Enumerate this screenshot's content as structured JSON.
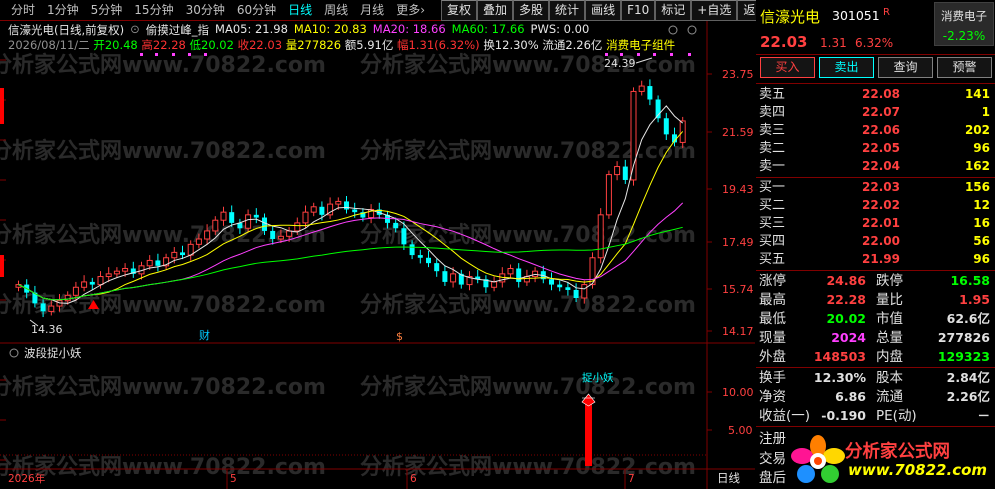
{
  "toolbar": {
    "tabs": [
      "分时",
      "1分钟",
      "5分钟",
      "15分钟",
      "30分钟",
      "60分钟",
      "日线",
      "周线",
      "月线",
      "更多›"
    ],
    "active_tab": "日线",
    "buttons": [
      "复权",
      "叠加",
      "多股",
      "统计",
      "画线",
      "F10",
      "标记",
      "+自选",
      "返回"
    ]
  },
  "info_line1": {
    "title": "信濠光电(日线,前复权)",
    "indicator": "偷摸过峰_指",
    "ma05": "MA05: 21.98",
    "ma10": "MA10: 20.83",
    "ma20": "MA20: 18.66",
    "ma60": "MA60: 17.66",
    "pws": "PWS: 0.00"
  },
  "info_line2": {
    "date": "2026/08/11/二",
    "open": "开20.48",
    "high": "高22.28",
    "low": "低20.02",
    "close": "收22.03",
    "volume": "量277826",
    "amount": "额5.91亿",
    "range": "幅1.31(6.32%)",
    "turnover": "换12.30%",
    "float": "流通2.26亿",
    "sector": "消费电子组件"
  },
  "price_axis": [
    "23.75",
    "21.59",
    "19.43",
    "17.49",
    "15.74",
    "14.17"
  ],
  "price_marks": {
    "max_label": "24.39",
    "min_label": "14.36"
  },
  "event_marks": {
    "fin": "财",
    "dollar": "$"
  },
  "sub_indicator": {
    "name": "波段捉小妖",
    "signal_label": "捉小妖",
    "axis": [
      "10.00",
      "5.00"
    ]
  },
  "date_axis": {
    "labels": [
      "2026年",
      "5",
      "6",
      "7"
    ],
    "period": "日线"
  },
  "watermark": "分析家公式网www.70822.com",
  "stock": {
    "name": "信濠光电",
    "code": "301051",
    "flag": "R",
    "sector": "消费电子",
    "sector_change": "-2.23%",
    "price": "22.03",
    "change": "1.31",
    "change_pct": "6.32%"
  },
  "trade_buttons": [
    "买入",
    "卖出",
    "查询",
    "预警"
  ],
  "order_book": {
    "asks": [
      {
        "label": "卖五",
        "price": "22.08",
        "vol": "141"
      },
      {
        "label": "卖四",
        "price": "22.07",
        "vol": "1"
      },
      {
        "label": "卖三",
        "price": "22.06",
        "vol": "202"
      },
      {
        "label": "卖二",
        "price": "22.05",
        "vol": "96"
      },
      {
        "label": "卖一",
        "price": "22.04",
        "vol": "162"
      }
    ],
    "bids": [
      {
        "label": "买一",
        "price": "22.03",
        "vol": "156"
      },
      {
        "label": "买二",
        "price": "22.02",
        "vol": "12"
      },
      {
        "label": "买三",
        "price": "22.01",
        "vol": "16"
      },
      {
        "label": "买四",
        "price": "22.00",
        "vol": "56"
      },
      {
        "label": "买五",
        "price": "21.99",
        "vol": "96"
      }
    ]
  },
  "stats": {
    "limit_up_label": "涨停",
    "limit_up": "24.86",
    "limit_down_label": "跌停",
    "limit_down": "16.58",
    "high_label": "最高",
    "high": "22.28",
    "vol_ratio_label": "量比",
    "vol_ratio": "1.95",
    "low_label": "最低",
    "low": "20.02",
    "mktcap_label": "市值",
    "mktcap": "62.6亿",
    "cur_label": "现量",
    "cur": "2024",
    "total_label": "总量",
    "total": "277826",
    "outer_label": "外盘",
    "outer": "148503",
    "inner_label": "内盘",
    "inner": "129323",
    "turnover_label": "换手",
    "turnover": "12.30%",
    "shares_label": "股本",
    "shares": "2.84亿",
    "nav_label": "净资",
    "nav": "6.86",
    "float_label": "流通",
    "float": "2.26亿",
    "eps_label": "收益(一)",
    "eps": "-0.190",
    "pe_label": "PE(动)",
    "pe": "－"
  },
  "bottom_labels": [
    "注册",
    "交易",
    "盘后"
  ],
  "logo": {
    "text": "分析家公式网",
    "url": "www.70822.com"
  },
  "colors": {
    "up": "#ff4040",
    "down": "#00ffff",
    "frame": "#800000"
  }
}
